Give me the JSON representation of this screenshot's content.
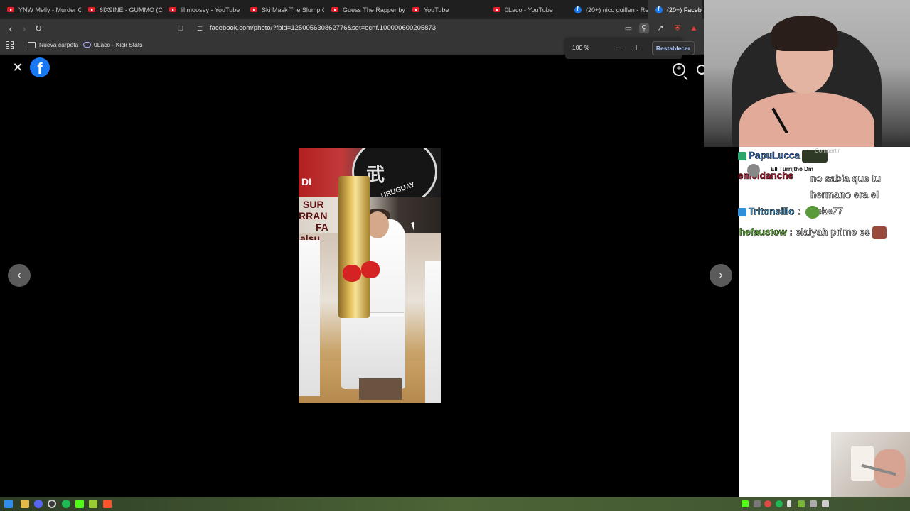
{
  "browser": {
    "tabs": [
      {
        "label": "YNW Melly - Murder C",
        "icon": "youtube-icon"
      },
      {
        "label": "6IX9INE - GUMMO (Of",
        "icon": "youtube-icon"
      },
      {
        "label": "lil moosey - YouTube",
        "icon": "youtube-icon"
      },
      {
        "label": "Ski Mask The Slump G",
        "icon": "youtube-icon"
      },
      {
        "label": "Guess The Rapper by E",
        "icon": "youtube-icon"
      },
      {
        "label": "YouTube",
        "icon": "youtube-icon"
      },
      {
        "label": "0Laco - YouTube",
        "icon": "youtube-icon"
      },
      {
        "label": "(20+) nico guillen - Re",
        "icon": "facebook-icon"
      },
      {
        "label": "(20+) Faceboo",
        "icon": "facebook-icon",
        "active": true
      }
    ],
    "url": "facebook.com/photo/?fbid=125005630862776&set=ecnf.100000600205873",
    "bookmarks": [
      {
        "label": "Nueva carpeta",
        "icon": "folder-icon"
      },
      {
        "label": "0Laco - Kick Stats",
        "icon": "kick-icon"
      }
    ],
    "zoom_popup": {
      "level": "100 %",
      "minus": "−",
      "plus": "+",
      "reset_label": "Restablecer"
    }
  },
  "photo_viewer": {
    "close_glyph": "✕",
    "logo_glyph": "f",
    "prev_glyph": "‹",
    "next_glyph": "›",
    "photo_text": {
      "banner_left": "DI",
      "banner_left2": "SUR",
      "banner_left3": "RRAN",
      "banner_left4": "FA",
      "banner_left5": "alsu",
      "seal_char": "武",
      "seal_text": "URUGUAY"
    }
  },
  "chat": {
    "alert": {
      "name": "Ell Túrrijthô Dm",
      "text": "Compartir"
    },
    "messages": [
      {
        "user": "PapuLucca",
        "user_color": "#3e7fd8",
        "text": "",
        "emote": true
      },
      {
        "user": "emeldanche",
        "user_color": "#d81e3a",
        "text": "no sabia que tu hermano era el peke77"
      },
      {
        "user": "Tritonsillo",
        "user_color": "#4fb0e8",
        "text": "",
        "emote": true
      },
      {
        "user": "hefaustow",
        "user_color": "#6fd13a",
        "text": "elaiyah prime es",
        "emote": true
      }
    ]
  },
  "colors": {
    "facebook_blue": "#1877f2",
    "youtube_red": "#e4212b",
    "reset_text": "#aec9ff"
  }
}
